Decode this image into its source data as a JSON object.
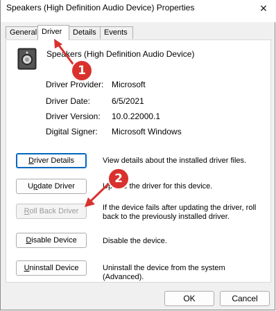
{
  "window": {
    "title": "Speakers (High Definition Audio Device) Properties",
    "close_glyph": "✕"
  },
  "tabs": [
    {
      "label": "General"
    },
    {
      "label": "Driver"
    },
    {
      "label": "Details"
    },
    {
      "label": "Events"
    }
  ],
  "device": {
    "name": "Speakers (High Definition Audio Device)",
    "icon": "speaker-icon"
  },
  "driver_info": [
    {
      "label": "Driver Provider:",
      "value": "Microsoft"
    },
    {
      "label": "Driver Date:",
      "value": "6/5/2021"
    },
    {
      "label": "Driver Version:",
      "value": "10.0.22000.1"
    },
    {
      "label": "Digital Signer:",
      "value": "Microsoft Windows"
    }
  ],
  "actions": [
    {
      "button": {
        "pre": "",
        "key": "D",
        "post": "river Details"
      },
      "description": "View details about the installed driver files."
    },
    {
      "button": {
        "pre": "U",
        "key": "p",
        "post": "date Driver"
      },
      "description": "Update the driver for this device."
    },
    {
      "button": {
        "pre": "",
        "key": "R",
        "post": "oll Back Driver"
      },
      "description": "If the device fails after updating the driver, roll back to the previously installed driver.",
      "disabled": true
    },
    {
      "button": {
        "pre": "",
        "key": "D",
        "post": "isable Device"
      },
      "description": "Disable the device."
    },
    {
      "button": {
        "pre": "",
        "key": "U",
        "post": "ninstall Device"
      },
      "description": "Uninstall the device from the system (Advanced)."
    }
  ],
  "footer": {
    "ok_label": "OK",
    "cancel_label": "Cancel"
  },
  "annotations": [
    {
      "number": "1",
      "color": "#d9322e"
    },
    {
      "number": "2",
      "color": "#d9322e"
    }
  ]
}
